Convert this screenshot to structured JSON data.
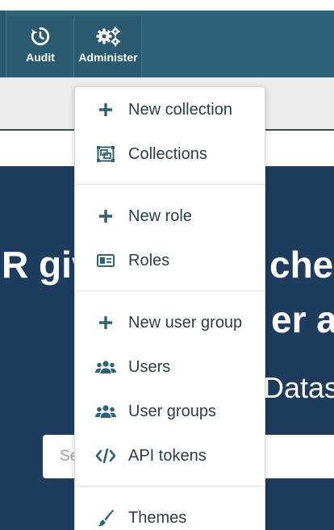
{
  "nav": {
    "audit_label": "Audit",
    "administer_label": "Administer"
  },
  "hero": {
    "line1_part_a": "R giv",
    "line1_part_b": "cher",
    "line2_part": "er ar",
    "line3_part": "Datas",
    "search_placeholder": "Se"
  },
  "dropdown": {
    "items": [
      {
        "label": "New collection",
        "icon": "plus-icon"
      },
      {
        "label": "Collections",
        "icon": "collections-icon"
      },
      {
        "label": "New role",
        "icon": "plus-icon"
      },
      {
        "label": "Roles",
        "icon": "id-card-icon"
      },
      {
        "label": "New user group",
        "icon": "plus-icon"
      },
      {
        "label": "Users",
        "icon": "users-icon"
      },
      {
        "label": "User groups",
        "icon": "users-icon"
      },
      {
        "label": "API tokens",
        "icon": "code-icon"
      },
      {
        "label": "Themes",
        "icon": "brush-icon"
      }
    ]
  },
  "colors": {
    "navbar": "#2e6479",
    "hero_background": "#1d3c5e",
    "icon_color": "#2e6479",
    "menu_text": "#2b3e4d"
  }
}
